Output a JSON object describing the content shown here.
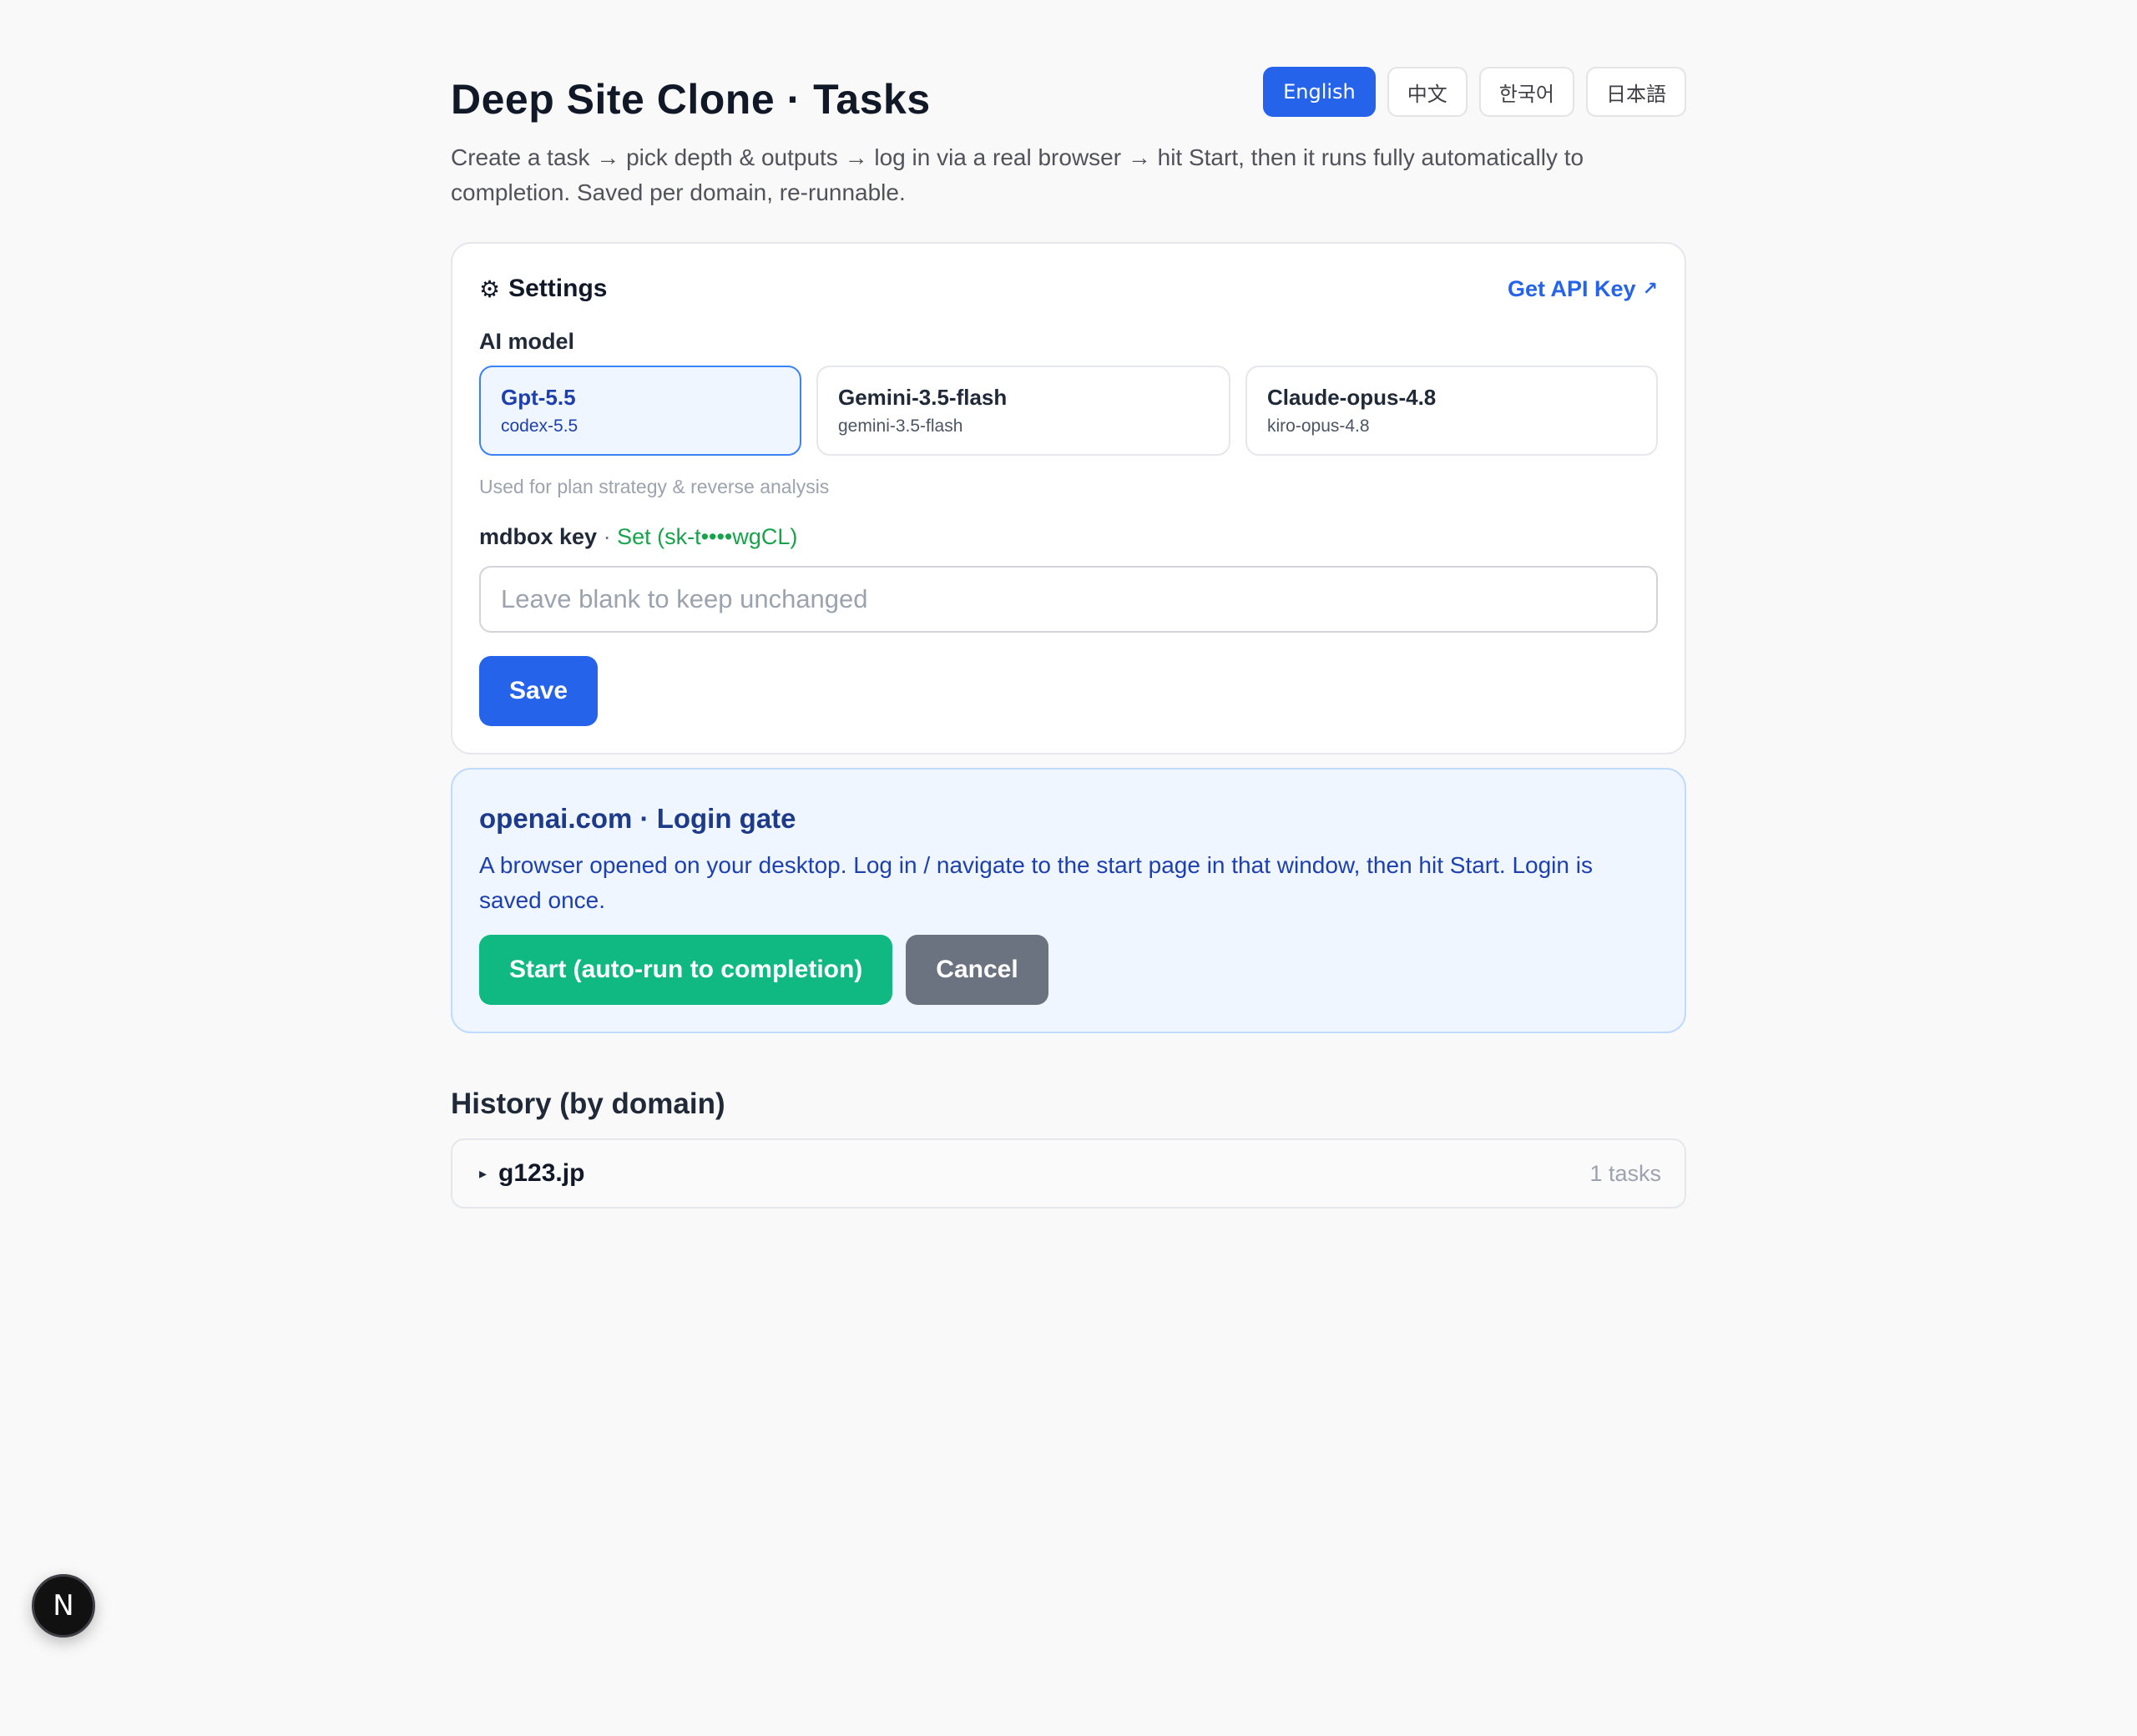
{
  "header": {
    "title": "Deep Site Clone · Tasks",
    "subtitle": "Create a task → pick depth & outputs → log in via a real browser → hit Start, then it runs fully automatically to completion. Saved per domain, re-runnable."
  },
  "languages": [
    {
      "label": "English",
      "active": true
    },
    {
      "label": "中文",
      "active": false
    },
    {
      "label": "한국어",
      "active": false
    },
    {
      "label": "日本語",
      "active": false
    }
  ],
  "settings": {
    "title": "Settings",
    "title_icon": "⚙",
    "api_link": "Get API Key",
    "api_link_icon": "↗",
    "model_label": "AI model",
    "models": [
      {
        "name": "Gpt-5.5",
        "sub": "codex-5.5",
        "selected": true
      },
      {
        "name": "Gemini-3.5-flash",
        "sub": "gemini-3.5-flash",
        "selected": false
      },
      {
        "name": "Claude-opus-4.8",
        "sub": "kiro-opus-4.8",
        "selected": false
      }
    ],
    "hint": "Used for plan strategy & reverse analysis",
    "key_label": "mdbox key",
    "key_separator": " · ",
    "key_status": "Set (sk-t••••wgCL)",
    "key_placeholder": "Leave blank to keep unchanged",
    "key_value": "",
    "save_label": "Save"
  },
  "login_gate": {
    "title": "openai.com · Login gate",
    "text": "A browser opened on your desktop. Log in / navigate to the start page in that window, then hit Start. Login is saved once.",
    "start_label": "Start (auto-run to completion)",
    "cancel_label": "Cancel"
  },
  "history": {
    "title": "History (by domain)",
    "items": [
      {
        "caret": "▸",
        "domain": "g123.jp",
        "count": "1 tasks"
      }
    ]
  },
  "badge": {
    "letter": "N"
  },
  "colors": {
    "primary": "#2563eb",
    "success": "#10b981",
    "neutral": "#6b7280",
    "status_green": "#16a34a",
    "gate_bg": "#eff6ff"
  }
}
